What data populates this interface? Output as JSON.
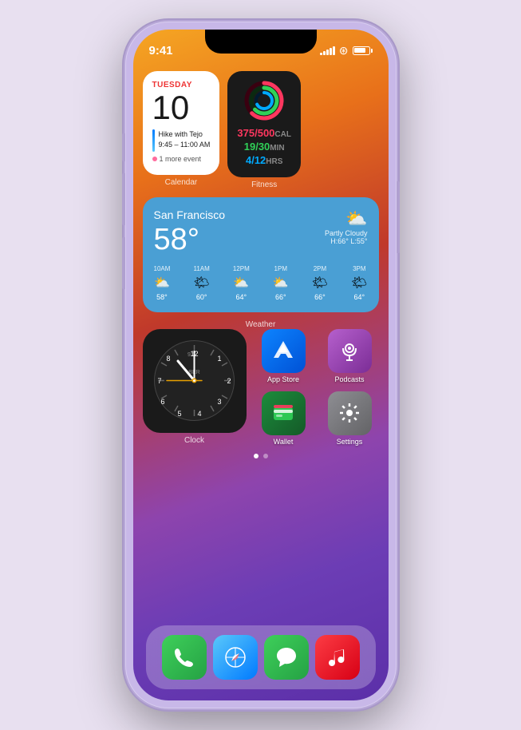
{
  "phone": {
    "status": {
      "time": "9:41",
      "signal_bars": [
        3,
        5,
        7,
        9,
        11
      ],
      "wifi": "wifi",
      "battery_level": 80
    },
    "calendar_widget": {
      "label": "Calendar",
      "day": "TUESDAY",
      "date": "10",
      "event_name": "Hike with Tejo",
      "event_time": "9:45 – 11:00 AM",
      "more_events": "1 more event"
    },
    "fitness_widget": {
      "label": "Fitness",
      "cal_current": "375",
      "cal_total": "500",
      "cal_unit": "CAL",
      "min_current": "19",
      "min_total": "30",
      "min_unit": "MIN",
      "hrs_current": "4",
      "hrs_total": "12",
      "hrs_unit": "HRS"
    },
    "weather_widget": {
      "label": "Weather",
      "city": "San Francisco",
      "temp": "58°",
      "condition": "Partly Cloudy",
      "high": "H:66°",
      "low": "L:55°",
      "forecast": [
        {
          "time": "10AM",
          "icon": "⛅",
          "temp": "58°"
        },
        {
          "time": "11AM",
          "icon": "🌤",
          "temp": "60°"
        },
        {
          "time": "12PM",
          "icon": "⛅",
          "temp": "64°"
        },
        {
          "time": "1PM",
          "icon": "⛅",
          "temp": "66°"
        },
        {
          "time": "2PM",
          "icon": "🌤",
          "temp": "66°"
        },
        {
          "time": "3PM",
          "icon": "🌤",
          "temp": "64°"
        }
      ]
    },
    "clock_widget": {
      "label": "Clock",
      "timezone": "BER"
    },
    "apps": [
      {
        "id": "app-store",
        "label": "App Store",
        "icon": "app-store"
      },
      {
        "id": "podcasts",
        "label": "Podcasts",
        "icon": "podcasts"
      },
      {
        "id": "wallet",
        "label": "Wallet",
        "icon": "wallet"
      },
      {
        "id": "settings",
        "label": "Settings",
        "icon": "settings"
      }
    ],
    "dock": [
      {
        "id": "phone",
        "label": "Phone"
      },
      {
        "id": "safari",
        "label": "Safari"
      },
      {
        "id": "messages",
        "label": "Messages"
      },
      {
        "id": "music",
        "label": "Music"
      }
    ],
    "page_dots": {
      "active": 0,
      "total": 2
    }
  }
}
